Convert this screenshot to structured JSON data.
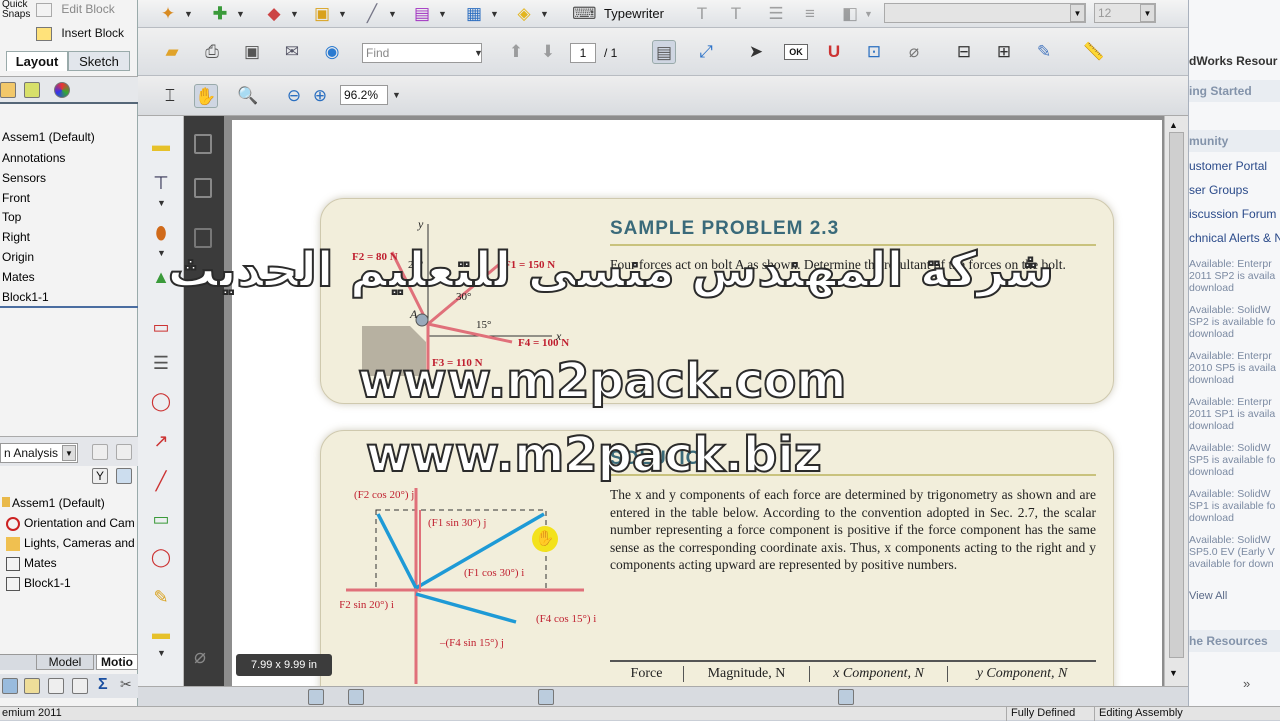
{
  "left_panel": {
    "quick_snaps": "Quick\nSnaps",
    "edit_block": "Edit Block",
    "insert_block": "Insert Block",
    "tabs": [
      "Layout",
      "Sketch"
    ],
    "tree": [
      "Assem1  (Default)",
      "Annotations",
      "Sensors",
      "Front",
      "Top",
      "Right",
      "Origin",
      "Mates",
      "Block1-1"
    ],
    "analysis_select": "n Analysis",
    "motion_tree": [
      "Assem1  (Default)",
      "Orientation and Cam",
      "Lights, Cameras and",
      "Mates",
      "Block1-1"
    ],
    "bottom_tabs": [
      "Model",
      "Motio"
    ]
  },
  "toolbar1": {
    "typewriter": "Typewriter",
    "font_size": "12"
  },
  "toolbar2": {
    "find_placeholder": "Find",
    "page_current": "1",
    "page_total": "/ 1",
    "ok_label": "OK"
  },
  "toolbar3": {
    "zoom": "96.2%"
  },
  "document": {
    "title": "SAMPLE PROBLEM 2.3",
    "problem_text": "Four forces act on bolt A as shown. Determine the resultant of the forces on the bolt.",
    "fig1_labels": [
      "F2 = 80 N",
      "F1 = 150 N",
      "F3 = 110 N",
      "F4 = 100 N",
      "20°",
      "30°",
      "15°",
      "A",
      "x",
      "y"
    ],
    "solution_heading": "SOLUTION",
    "solution_text": "The x and y components of each force are determined by trigonometry as shown and are entered in the table below. According to the convention adopted in Sec. 2.7, the scalar number representing a force component is positive if the force component has the same sense as the corresponding coordinate axis. Thus, x components acting to the right and y components acting upward are represented by positive numbers.",
    "fig2_labels": [
      "(F2 cos 20°) j",
      "(F1 sin 30°) j",
      "(F1 cos 30°) i",
      "–(F2 sin 20°) i",
      "(F4 cos 15°) i",
      "–(F4 sin 15°) j"
    ],
    "table_headers": [
      "Force",
      "Magnitude, N",
      "x Component, N",
      "y Component, N"
    ],
    "page_size_tip": "7.99 x 9.99 in"
  },
  "watermark": {
    "arabic": "شركة المهندس منسى للتعليم الحديث",
    "url1": "www.m2pack.com",
    "url2": "www.m2pack.biz"
  },
  "right_panel": {
    "title": "dWorks Resour",
    "getting_started": "ing Started",
    "community": "munity",
    "links": [
      "ustomer Portal",
      "ser Groups",
      "iscussion Forum",
      "chnical Alerts & N"
    ],
    "alerts": [
      "Available: Enterpr\n2011 SP2 is availa\ndownload",
      "Available: SolidW\nSP2 is available fo\ndownload",
      "Available: Enterpr\n2010 SP5 is availa\ndownload",
      "Available: Enterpr\n2011 SP1 is availa\ndownload",
      "Available: SolidW\nSP5 is available fo\ndownload",
      "Available: SolidW\nSP1 is available fo\ndownload",
      "Available: SolidW\nSP5.0 EV (Early V\navailable for down"
    ],
    "view_all": "View All",
    "resources": "he Resources"
  },
  "status_bar": {
    "app": "emium 2011",
    "state": "Fully Defined",
    "mode": "Editing Assembly"
  }
}
